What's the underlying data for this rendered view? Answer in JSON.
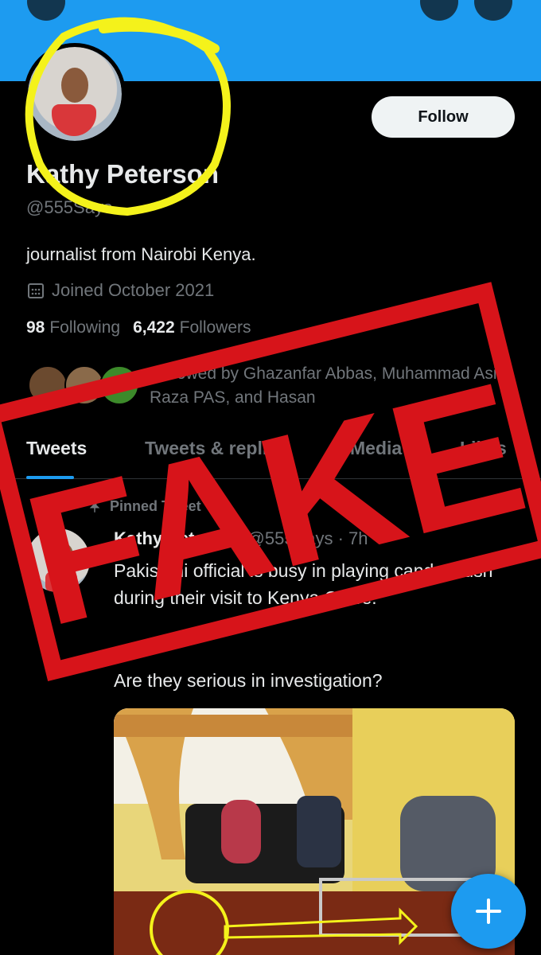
{
  "profile": {
    "name": "Kathy Peterson",
    "handle": "@555Says",
    "bio": "journalist from Nairobi Kenya.",
    "joined": "Joined October 2021",
    "following_count": "98",
    "following_label": "Following",
    "followers_count": "6,422",
    "followers_label": "Followers",
    "followed_by": "Followed by Ghazanfar Abbas, Muhammad Asif Raza PAS, and Hasan"
  },
  "header": {
    "follow_label": "Follow"
  },
  "tabs": [
    {
      "label": "Tweets"
    },
    {
      "label": "Tweets & replies"
    },
    {
      "label": "Media"
    },
    {
      "label": "Likes"
    }
  ],
  "tweet": {
    "pinned_label": "Pinned Tweet",
    "author": "Kathy Peterson",
    "meta": "@555Says · 7h",
    "text": "Pakistani official is busy in playing candy crush during their visit to Kenya Office.",
    "text2": "Are they serious in investigation?"
  },
  "overlay": {
    "stamp_text": "FAKE"
  },
  "colors": {
    "accent": "#1d9bf0",
    "stamp": "#d7141a",
    "highlight": "#f4f21b"
  },
  "icons": [
    "back-icon",
    "search-icon",
    "more-icon",
    "calendar-icon",
    "pin-icon",
    "compose-plus-icon"
  ]
}
